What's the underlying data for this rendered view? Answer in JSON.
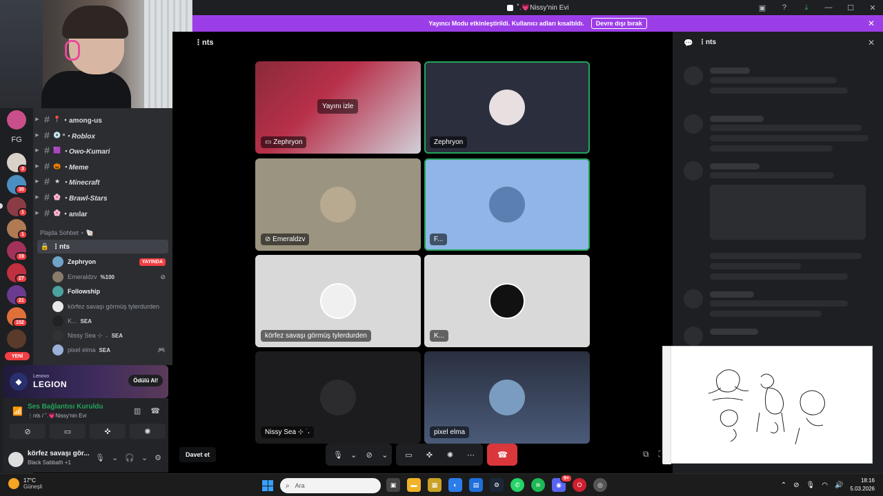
{
  "window": {
    "title": "˚.💗Nissy'nin Evi"
  },
  "banner": {
    "text": "Yayıncı Modu etkinleştirildi. Kullanıcı adları kısaltıldı.",
    "button": "Devre dışı bırak"
  },
  "rail": {
    "fg_label": "FG",
    "badges": [
      "3",
      "35",
      "1",
      "1",
      "19",
      "27",
      "21",
      "152"
    ],
    "new_label": "YENİ"
  },
  "channels": [
    {
      "icon": "📍",
      "name": "・among-us"
    },
    {
      "icon": "💿",
      "name": "°・Roblox"
    },
    {
      "icon": "🟪",
      "name": "・Owo-Kumari"
    },
    {
      "icon": "🎃",
      "name": "・Meme"
    },
    {
      "icon": "★",
      "name": "・Minecraft"
    },
    {
      "icon": "🌸",
      "name": "・Brawl-Stars"
    },
    {
      "icon": "🌸",
      "name": "・anılar"
    }
  ],
  "category": "Plajda Sohbet ⋆ 🐚",
  "voice_channel": "⋮nts",
  "voice_users": [
    {
      "name": "Zephryon",
      "live": "YAYINDA",
      "tag": ""
    },
    {
      "name": "Emeraldzv",
      "live": "",
      "tag": "%100"
    },
    {
      "name": "Followship",
      "live": "",
      "tag": ""
    },
    {
      "name": "körfez savaşı görmüş tylerdurden",
      "live": "",
      "tag": ""
    },
    {
      "name": "K...",
      "live": "",
      "tag": "SEA"
    },
    {
      "name": "Nissy Sea ⊹ ࣪ ˖",
      "live": "",
      "tag": "SEA"
    },
    {
      "name": "pixel elma",
      "live": "",
      "tag": "SEA"
    }
  ],
  "promo": {
    "brand_small": "Lenovo",
    "brand_big": "LEGION",
    "button": "Ödülü Al!"
  },
  "voice_panel": {
    "status": "Ses Bağlantısı Kuruldu",
    "location": "⋮nts / ˚.💗Nissy'nin Evi"
  },
  "user": {
    "name": "körfez savaşı gör...",
    "status": "Black Sabbath +1"
  },
  "main": {
    "channel_title": "⋮nts",
    "tiles": [
      {
        "name": "Zephryon",
        "watch": "Yayını izle",
        "stream": true
      },
      {
        "name": "Zephryon"
      },
      {
        "name": "Emeraldzv"
      },
      {
        "name": "F..."
      },
      {
        "name": "körfez savaşı görmüş tylerdurden"
      },
      {
        "name": "K..."
      },
      {
        "name": "Nissy Sea ⊹ ࣪ ˖"
      },
      {
        "name": "pixel elma"
      }
    ],
    "invite": "Davet et"
  },
  "right_panel": {
    "title": "⋮nts"
  },
  "taskbar": {
    "temp": "17°C",
    "weather": "Güneşli",
    "search_placeholder": "Ara",
    "time": "18:16",
    "date": "5.03.2026",
    "discord_badge": "9+"
  },
  "colors": {
    "accent": "#9c3ee8",
    "speaking": "#23a55a",
    "danger": "#da373c"
  }
}
